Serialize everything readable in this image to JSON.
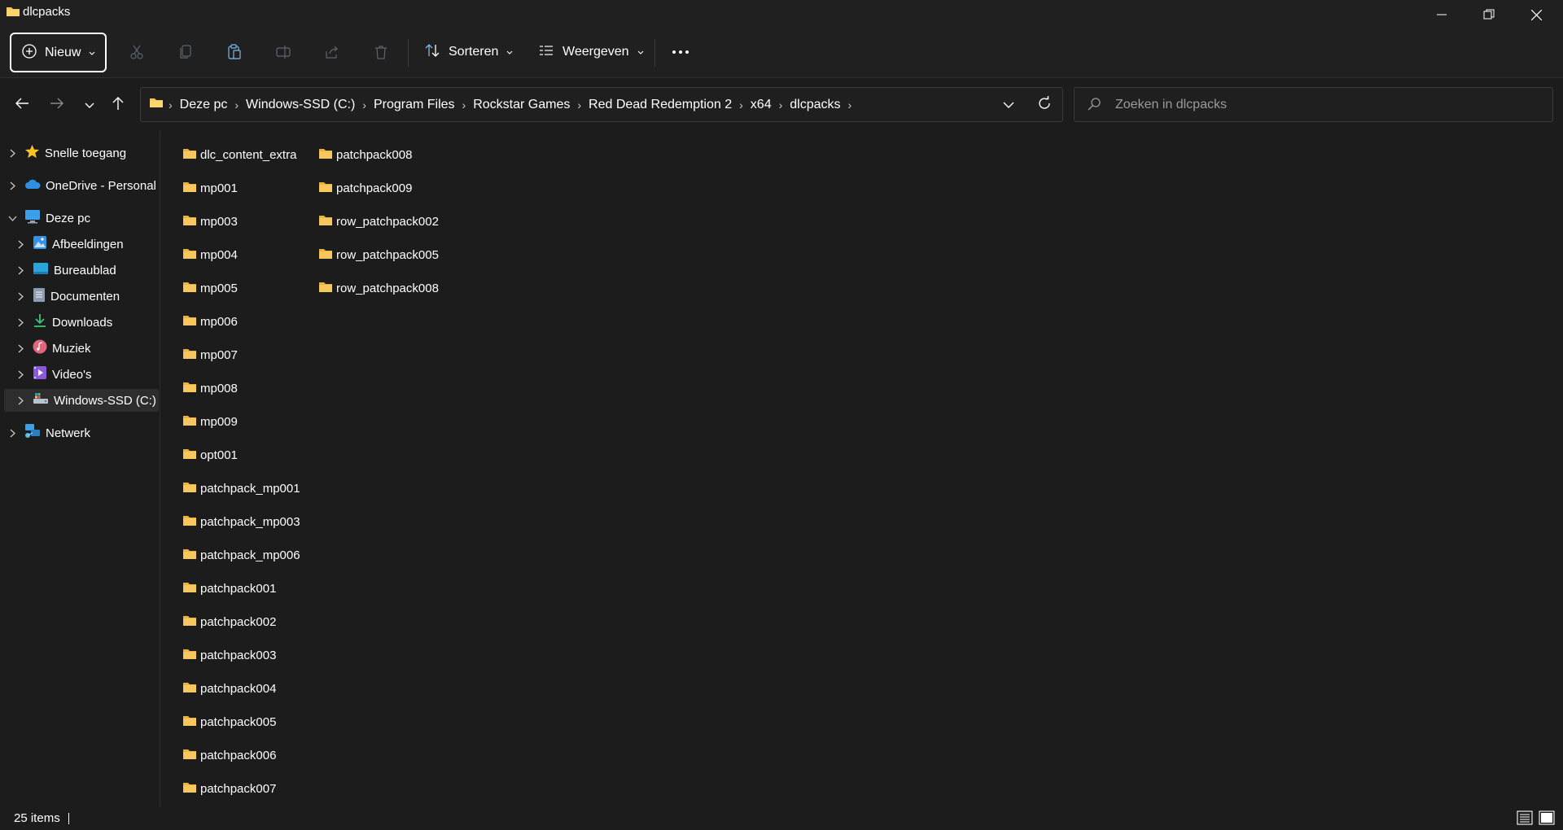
{
  "window": {
    "title": "dlcpacks"
  },
  "toolbar": {
    "new_label": "Nieuw",
    "sort_label": "Sorteren",
    "view_label": "Weergeven"
  },
  "breadcrumb": [
    "Deze pc",
    "Windows-SSD (C:)",
    "Program Files",
    "Rockstar Games",
    "Red Dead Redemption 2",
    "x64",
    "dlcpacks"
  ],
  "search": {
    "placeholder": "Zoeken in dlcpacks"
  },
  "sidebar": {
    "items": [
      {
        "label": "Snelle toegang",
        "icon": "star-icon",
        "color": "#f8c22a"
      },
      {
        "label": "OneDrive - Personal",
        "icon": "cloud-icon",
        "color": "#2f8fe0"
      },
      {
        "label": "Deze pc",
        "icon": "pc-icon",
        "color": "#3aa0e8"
      },
      {
        "label": "Afbeeldingen",
        "icon": "pictures-icon",
        "color": "#3a8fe0"
      },
      {
        "label": "Bureaublad",
        "icon": "desktop-icon",
        "color": "#29a6d9"
      },
      {
        "label": "Documenten",
        "icon": "documents-icon",
        "color": "#8d9bb0"
      },
      {
        "label": "Downloads",
        "icon": "download-icon",
        "color": "#3ec27a"
      },
      {
        "label": "Muziek",
        "icon": "music-icon",
        "color": "#e0677a"
      },
      {
        "label": "Video's",
        "icon": "video-icon",
        "color": "#8a5ad8"
      },
      {
        "label": "Windows-SSD (C:)",
        "icon": "drive-icon",
        "color": "#b9c3cf"
      },
      {
        "label": "Netwerk",
        "icon": "network-icon",
        "color": "#3aa0e8"
      }
    ]
  },
  "files": {
    "column1": [
      "dlc_content_extra",
      "mp001",
      "mp003",
      "mp004",
      "mp005",
      "mp006",
      "mp007",
      "mp008",
      "mp009",
      "opt001",
      "patchpack_mp001",
      "patchpack_mp003",
      "patchpack_mp006",
      "patchpack001",
      "patchpack002",
      "patchpack003",
      "patchpack004",
      "patchpack005",
      "patchpack006",
      "patchpack007"
    ],
    "column2": [
      "patchpack008",
      "patchpack009",
      "row_patchpack002",
      "row_patchpack005",
      "row_patchpack008"
    ]
  },
  "status": {
    "item_count": "25 items"
  },
  "colors": {
    "folder": "#f6c75c",
    "background": "#1c1c1c",
    "accent": "#4cc2ff"
  }
}
